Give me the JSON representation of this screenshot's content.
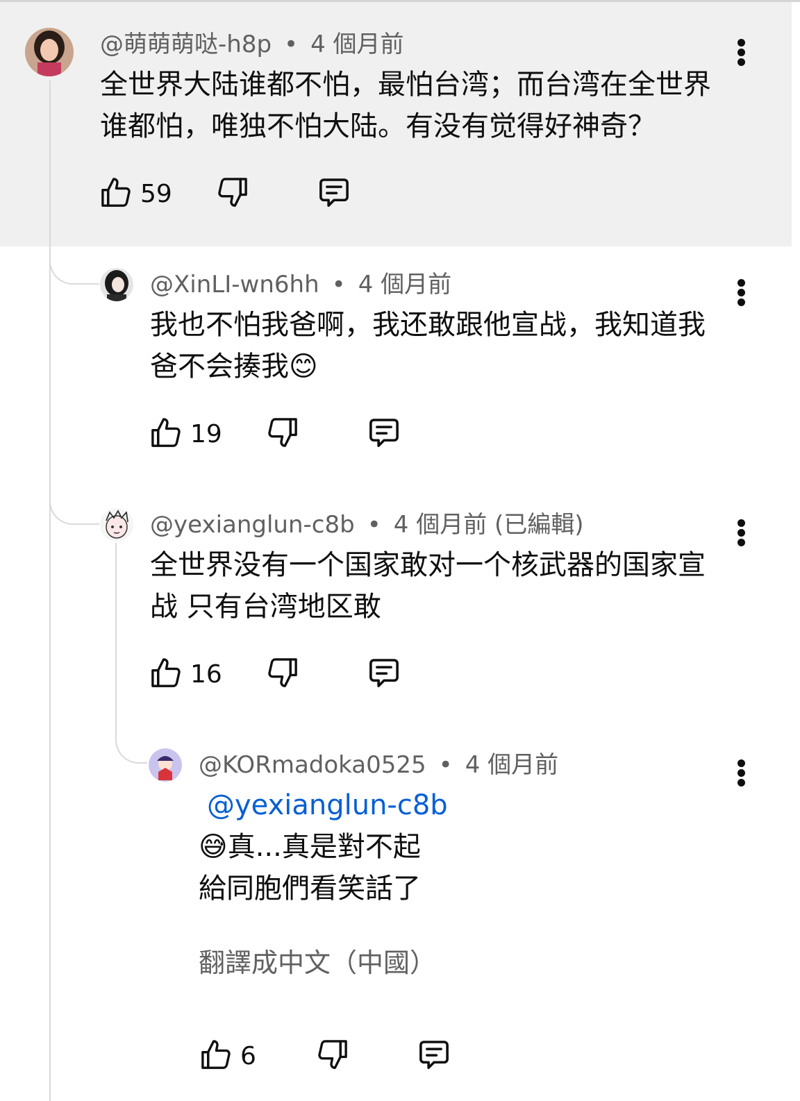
{
  "comments": [
    {
      "author": "@萌萌萌哒-h8p",
      "time": "4 個月前",
      "lines": [
        "全世界大陆谁都不怕，最怕台湾；而台湾在全世界",
        "谁都怕，唯独不怕大陆。有没有觉得好神奇？"
      ],
      "likes": "59"
    },
    {
      "author": "@XinLI-wn6hh",
      "time": "4 個月前",
      "lines": [
        "我也不怕我爸啊，我还敢跟他宣战，我知道我",
        "爸不会揍我😊"
      ],
      "likes": "19"
    },
    {
      "author": "@yexianglun-c8b",
      "time": "4 個月前 (已編輯)",
      "lines": [
        "全世界没有一个国家敢对一个核武器的国家宣",
        "战 只有台湾地区敢"
      ],
      "likes": "16"
    },
    {
      "author": "@KORmadoka0525",
      "time": "4 個月前",
      "mention": "@yexianglun-c8b",
      "lines": [
        "😅真...真是對不起",
        "給同胞們看笑話了"
      ],
      "translate": "翻譯成中文（中國）",
      "likes": "6"
    }
  ],
  "icons": {
    "like": "thumb-up-icon",
    "dislike": "thumb-down-icon",
    "reply": "reply-comment-icon",
    "more": "more-vert-icon"
  },
  "colors": {
    "mention": "#065fd4",
    "highlight_bg": "#f0f0f0",
    "meta_text": "#606060"
  }
}
